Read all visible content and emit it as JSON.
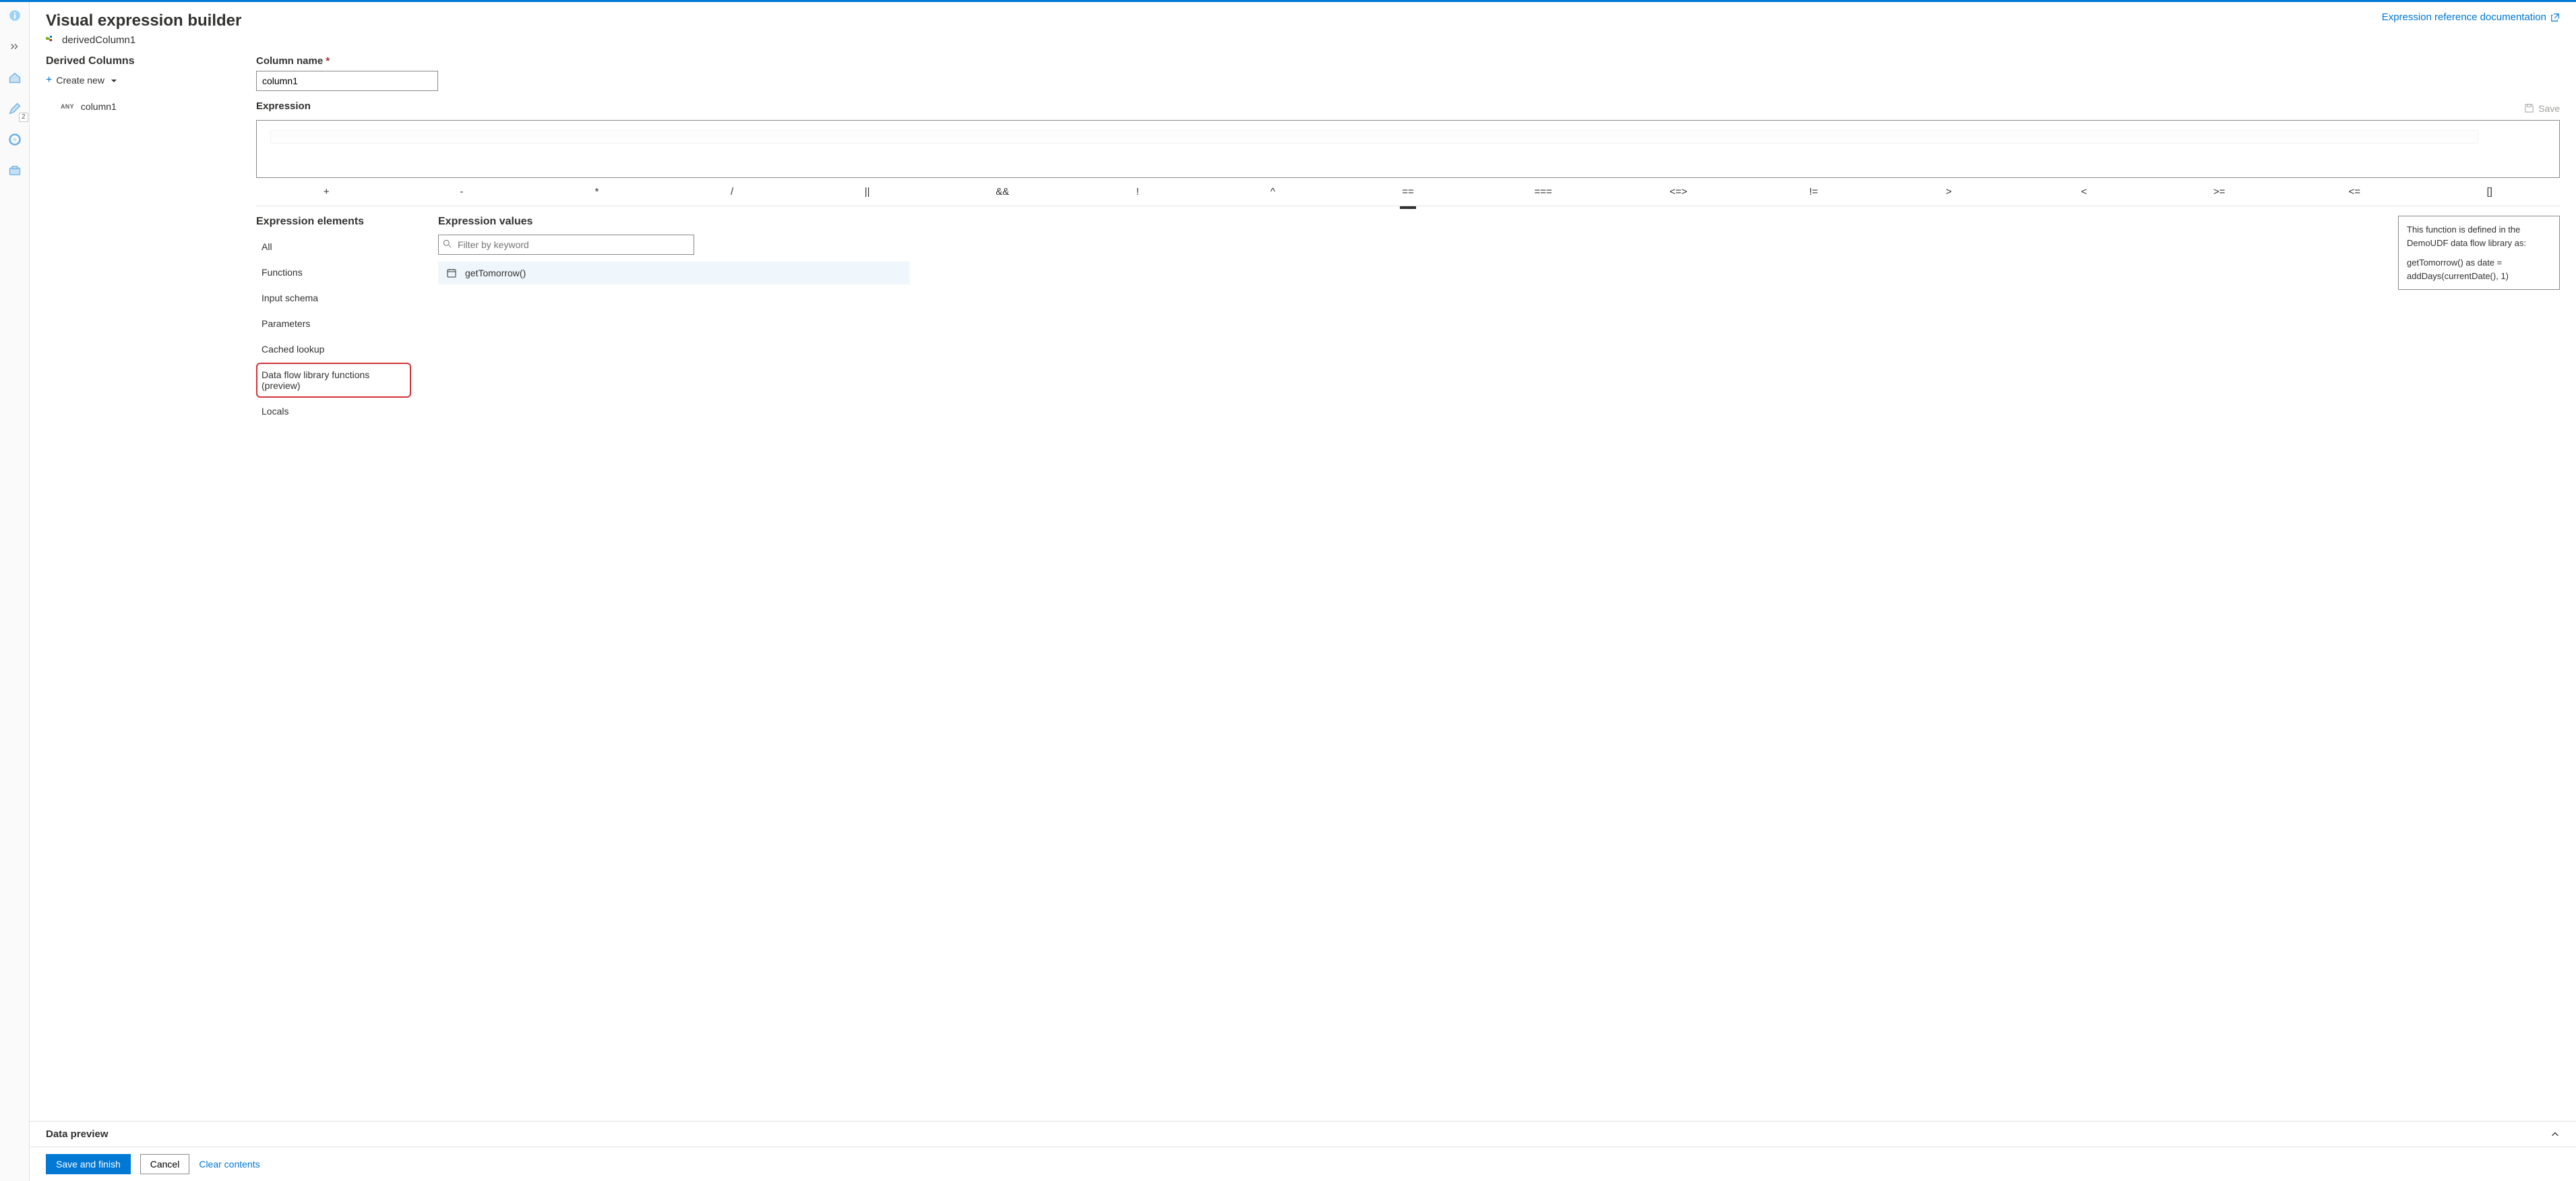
{
  "header": {
    "title": "Visual expression builder",
    "node_name": "derivedColumn1",
    "doc_link": "Expression reference documentation"
  },
  "sidebar": {
    "heading": "Derived Columns",
    "create_label": "Create new",
    "columns": [
      {
        "type_badge": "ANY",
        "name": "column1"
      }
    ]
  },
  "form": {
    "column_name_label": "Column name",
    "column_name_value": "column1",
    "expression_label": "Expression",
    "save_label": "Save"
  },
  "operators": [
    "+",
    "-",
    "*",
    "/",
    "||",
    "&&",
    "!",
    "^",
    "==",
    "===",
    "<=>",
    "!=",
    ">",
    "<",
    ">=",
    "<=",
    "[]"
  ],
  "elements": {
    "heading": "Expression elements",
    "items": [
      "All",
      "Functions",
      "Input schema",
      "Parameters",
      "Cached lookup",
      "Data flow library functions (preview)",
      "Locals"
    ],
    "highlighted_index": 5
  },
  "values": {
    "heading": "Expression values",
    "filter_placeholder": "Filter by keyword",
    "results": [
      {
        "icon": "calendar-icon",
        "label": "getTomorrow()"
      }
    ],
    "tooltip": {
      "line1": "This function is defined in the DemoUDF data flow library as:",
      "line2": "getTomorrow() as date = addDays(currentDate(), 1)"
    }
  },
  "preview_label": "Data preview",
  "footer": {
    "save_finish": "Save and finish",
    "cancel": "Cancel",
    "clear": "Clear contents"
  },
  "rail": {
    "pencil_badge": "2"
  }
}
